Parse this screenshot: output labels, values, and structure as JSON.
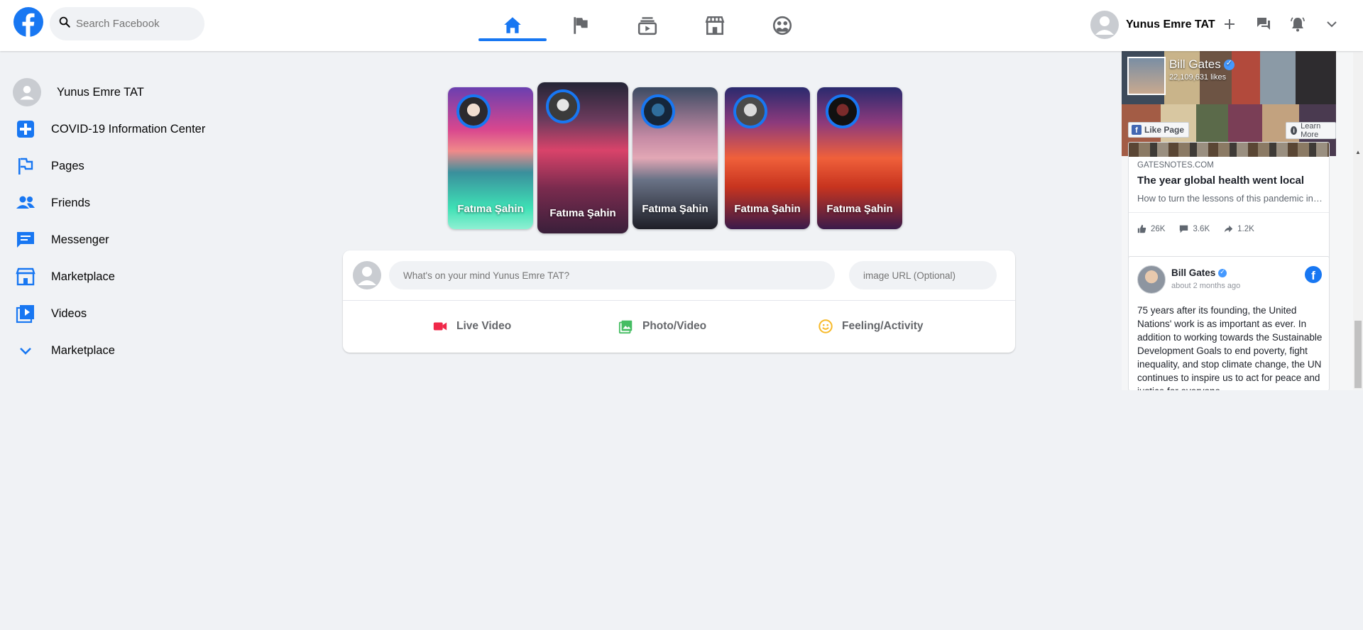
{
  "header": {
    "logo_icon": "facebook-logo-icon",
    "search_placeholder": "Search Facebook",
    "nav_tabs": [
      {
        "name": "home",
        "icon": "home-icon",
        "active": true
      },
      {
        "name": "pages",
        "icon": "flag-icon",
        "active": false
      },
      {
        "name": "watch",
        "icon": "watch-icon",
        "active": false
      },
      {
        "name": "marketplace",
        "icon": "marketplace-icon",
        "active": false
      },
      {
        "name": "groups",
        "icon": "groups-icon",
        "active": false
      }
    ],
    "user_name": "Yunus Emre TAT",
    "right_icons": [
      "plus-icon",
      "messenger-icon",
      "bell-icon",
      "chevron-down-icon"
    ]
  },
  "sidebar": {
    "items": [
      {
        "label": "Yunus Emre TAT",
        "icon": "avatar-icon"
      },
      {
        "label": "COVID-19 Information Center",
        "icon": "covid-cross-icon"
      },
      {
        "label": "Pages",
        "icon": "flag-icon"
      },
      {
        "label": "Friends",
        "icon": "friends-icon"
      },
      {
        "label": "Messenger",
        "icon": "messenger-icon"
      },
      {
        "label": "Marketplace",
        "icon": "marketplace-icon"
      },
      {
        "label": "Videos",
        "icon": "video-icon"
      },
      {
        "label": "Marketplace",
        "icon": "chevron-down-icon"
      }
    ]
  },
  "stories": [
    {
      "name": "Fatıma Şahin"
    },
    {
      "name": "Fatıma Şahin"
    },
    {
      "name": "Fatıma Şahin"
    },
    {
      "name": "Fatıma Şahin"
    },
    {
      "name": "Fatıma Şahin"
    }
  ],
  "composer": {
    "status_placeholder": "What's on your mind Yunus Emre TAT?",
    "url_placeholder": "image URL (Optional)",
    "actions": [
      {
        "label": "Live Video",
        "icon": "live-video-icon",
        "color": "#f02849"
      },
      {
        "label": "Photo/Video",
        "icon": "photo-icon",
        "color": "#45bd62"
      },
      {
        "label": "Feeling/Activity",
        "icon": "smiley-icon",
        "color": "#f7b928"
      }
    ]
  },
  "widget": {
    "page_name": "Bill Gates",
    "page_likes": "22,109,631 likes",
    "like_button": "Like Page",
    "learn_more": "Learn More",
    "link_card": {
      "domain": "GATESNOTES.COM",
      "headline": "The year global health went local",
      "subtitle": "How to turn the lessons of this pandemic into...",
      "likes": "26K",
      "comments": "3.6K",
      "shares": "1.2K"
    },
    "post": {
      "author": "Bill Gates",
      "time": "about 2 months ago",
      "body": "75 years after its founding, the United Nations' work is as important as ever. In addition to working towards the Sustainable Development Goals to end poverty, fight inequality, and stop climate change, the UN continues to inspire us to act for peace and justice for everyone."
    }
  },
  "colors": {
    "brand": "#1877f2",
    "background": "#f0f2f5"
  }
}
